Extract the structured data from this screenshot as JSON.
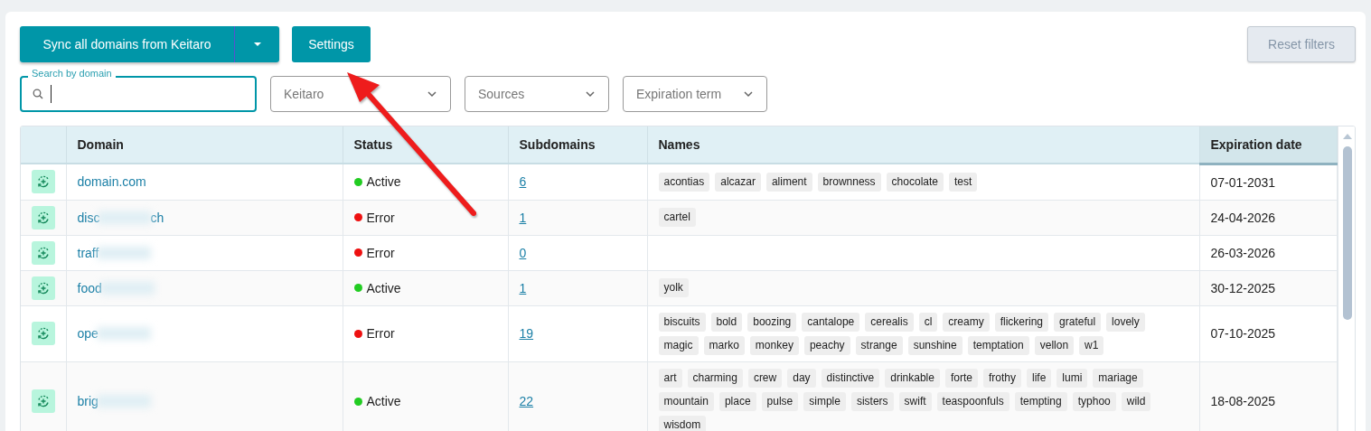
{
  "toolbar": {
    "sync_button": "Sync all domains from Keitaro",
    "settings_button": "Settings",
    "reset_button": {
      "label": "Reset filters",
      "disabled": true
    }
  },
  "filters": {
    "search": {
      "label": "Search by domain",
      "focused": true
    },
    "selects": [
      {
        "placeholder": "Keitaro"
      },
      {
        "placeholder": "Sources"
      },
      {
        "placeholder": "Expiration term"
      }
    ]
  },
  "table": {
    "columns": [
      {
        "label": "Domain",
        "sorted": false
      },
      {
        "label": "Status",
        "sorted": false
      },
      {
        "label": "Subdomains",
        "sorted": false
      },
      {
        "label": "Names",
        "sorted": false
      },
      {
        "label": "Expiration date",
        "sorted": true
      }
    ],
    "rows": [
      {
        "domain": "domain.com",
        "blurred": false,
        "status": "Active",
        "color": "#22cc22",
        "subdomains": "6",
        "names": [
          "acontias",
          "alcazar",
          "aliment",
          "brownness",
          "chocolate",
          "test"
        ],
        "expiration": "07-01-2031"
      },
      {
        "domain": "disc",
        "domain_end": "ch",
        "blurred": true,
        "status": "Error",
        "color": "#ee1111",
        "subdomains": "1",
        "names": [
          "cartel"
        ],
        "expiration": "24-04-2026"
      },
      {
        "domain": "traff",
        "blurred": true,
        "status": "Error",
        "color": "#ee1111",
        "subdomains": "0",
        "names": [],
        "expiration": "26-03-2026"
      },
      {
        "domain": "food",
        "blurred": true,
        "status": "Active",
        "color": "#22cc22",
        "subdomains": "1",
        "names": [
          "yolk"
        ],
        "expiration": "30-12-2025"
      },
      {
        "domain": "ope",
        "blurred": true,
        "status": "Error",
        "color": "#ee1111",
        "subdomains": "19",
        "names": [
          "biscuits",
          "bold",
          "boozing",
          "cantalope",
          "cerealis",
          "cl",
          "creamy",
          "flickering",
          "grateful",
          "lovely",
          "magic",
          "marko",
          "monkey",
          "peachy",
          "strange",
          "sunshine",
          "temptation",
          "vellon",
          "w1"
        ],
        "expiration": "07-10-2025"
      },
      {
        "domain": "brig",
        "blurred": true,
        "status": "Active",
        "color": "#22cc22",
        "subdomains": "22",
        "names": [
          "art",
          "charming",
          "crew",
          "day",
          "distinctive",
          "drinkable",
          "forte",
          "frothy",
          "life",
          "lumi",
          "mariage",
          "mountain",
          "place",
          "pulse",
          "simple",
          "sisters",
          "swift",
          "teaspoonfuls",
          "tempting",
          "typhoo",
          "wild",
          "wisdom"
        ],
        "expiration": "18-08-2025"
      }
    ]
  }
}
